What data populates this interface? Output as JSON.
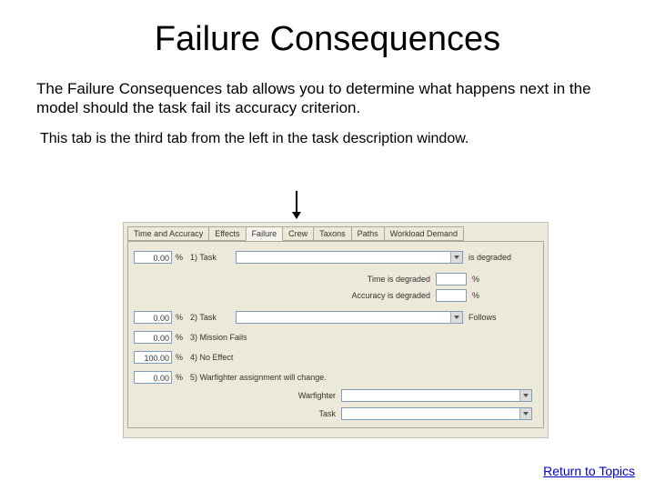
{
  "title": "Failure Consequences",
  "intro": "The Failure Consequences tab allows you to determine what happens next in the model should the task fail its accuracy criterion.",
  "subnote": "This tab is the third tab from the left in the task description window.",
  "return_link": "Return to Topics",
  "panel": {
    "tabs": [
      "Time and Accuracy",
      "Effects",
      "Failure",
      "Crew",
      "Taxons",
      "Paths",
      "Workload Demand"
    ],
    "active_tab_index": 2,
    "rows": {
      "r1": {
        "value": "0.00",
        "pct": "%",
        "label": "1) Task",
        "suffix": "is degraded"
      },
      "time_degraded_label": "Time is degraded",
      "acc_degraded_label": "Accuracy is degraded",
      "pct_unit": "%",
      "r2": {
        "value": "0.00",
        "pct": "%",
        "label": "2) Task",
        "suffix": "Follows"
      },
      "r3": {
        "value": "0.00",
        "pct": "%",
        "label": "3) Mission Fails"
      },
      "r4": {
        "value": "100.00",
        "pct": "%",
        "label": "4) No Effect"
      },
      "r5": {
        "value": "0.00",
        "pct": "%",
        "label": "5) Warfighter assignment will change."
      },
      "warfighter_label": "Warfighter",
      "task_label": "Task"
    }
  }
}
